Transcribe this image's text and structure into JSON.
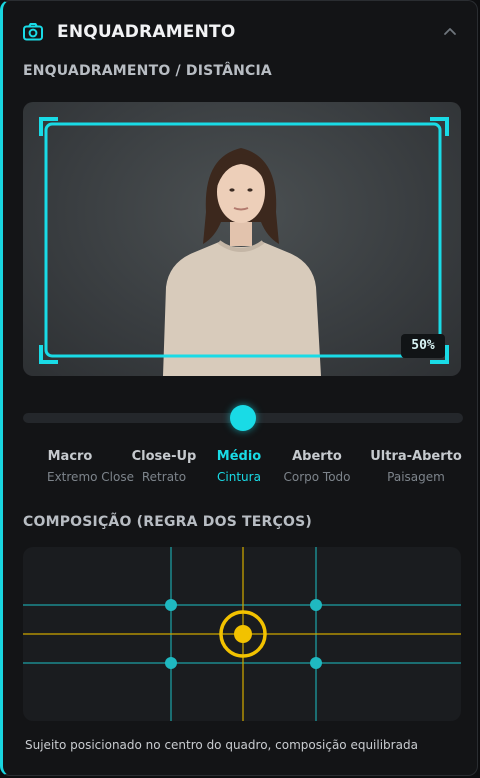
{
  "header": {
    "title": "ENQUADRAMENTO",
    "camera_icon": "camera-icon",
    "collapse_icon": "chevron-up-icon"
  },
  "framing": {
    "section_label": "ENQUADRAMENTO / DISTÂNCIA",
    "zoom_label": "50%",
    "slider_value": 0.5,
    "options": [
      {
        "name": "Macro",
        "sub": "Extremo Close",
        "active": false
      },
      {
        "name": "Close-Up",
        "sub": "Retrato",
        "active": false
      },
      {
        "name": "Médio",
        "sub": "Cintura",
        "active": true
      },
      {
        "name": "Aberto",
        "sub": "Corpo Todo",
        "active": false
      },
      {
        "name": "Ultra-Aberto",
        "sub": "Paisagem",
        "active": false
      }
    ]
  },
  "composition": {
    "section_label": "COMPOSIÇÃO (REGRA DOS TERÇOS)",
    "description": "Sujeito posicionado no centro do quadro, composição equilibrada"
  },
  "colors": {
    "accent": "#19dbe6",
    "focus": "#f2c200",
    "panel": "#131416"
  }
}
